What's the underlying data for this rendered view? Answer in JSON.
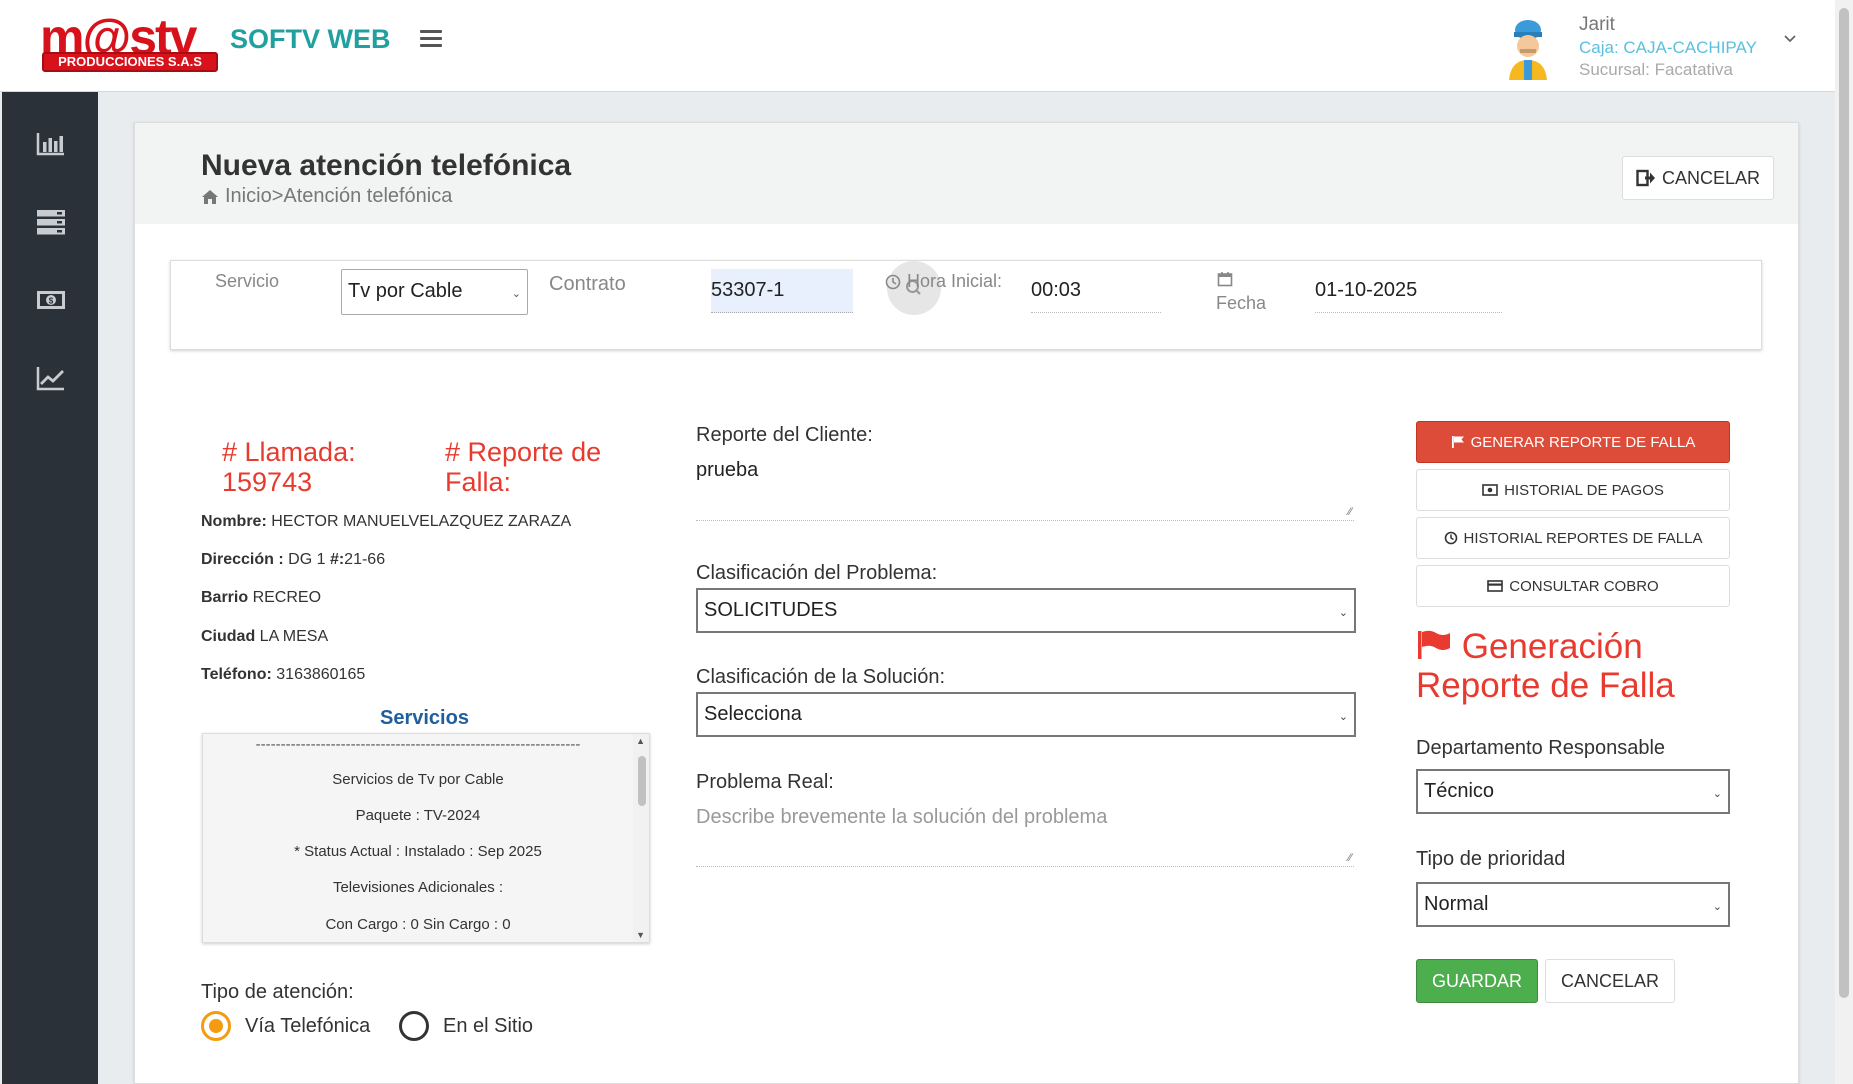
{
  "header": {
    "logo_text_main": "m@stv",
    "logo_text_sub": "PRODUCCIONES S.A.S",
    "app_name": "SOFTV WEB",
    "menu_icon": "hamburger-icon",
    "user": {
      "name": "Jarit",
      "caja": "Caja: CAJA-CACHIPAY",
      "sucursal": "Sucursal: Facatativa",
      "avatar_icon": "user-avatar-icon",
      "dropdown_icon": "chevron-down-icon"
    }
  },
  "sidebar": {
    "items": [
      {
        "icon": "bar-chart-icon"
      },
      {
        "icon": "server-icon"
      },
      {
        "icon": "money-icon"
      },
      {
        "icon": "line-chart-icon"
      }
    ]
  },
  "page": {
    "title": "Nueva atención telefónica",
    "breadcrumb": "Inicio>Atención telefónica",
    "cancel_label": "CANCELAR"
  },
  "filters": {
    "servicio_label": "Servicio",
    "servicio_value": "Tv por Cable",
    "contrato_label": "Contrato",
    "contrato_value": "53307-1",
    "hora_label": "Hora Inicial:",
    "hora_value": "00:03",
    "fecha_label": "Fecha",
    "fecha_value": "01-10-2025"
  },
  "left": {
    "llamada_label": "# Llamada:",
    "llamada_value": "159743",
    "reporte_label": "# Reporte de Falla:",
    "nombre_label": "Nombre:",
    "nombre_value": "HECTOR MANUELVELAZQUEZ ZARAZA",
    "direccion_label": "Dirección :",
    "direccion_value": "DG 1",
    "direccion_num_label": "#:",
    "direccion_num_value": "21-66",
    "barrio_label": "Barrio",
    "barrio_value": "RECREO",
    "ciudad_label": "Ciudad",
    "ciudad_value": "LA MESA",
    "telefono_label": "Teléfono:",
    "telefono_value": "3163860165",
    "servicios_title": "Servicios",
    "servicios_lines": [
      "-----------------------------------------------------------------",
      "Servicios de Tv por Cable",
      "Paquete : TV-2024",
      "* Status Actual : Instalado : Sep 2025",
      "Televisiones Adicionales :",
      "Con Cargo : 0 Sin Cargo : 0"
    ],
    "tipo_label": "Tipo de atención:",
    "tipo_options": [
      "Vía Telefónica",
      "En el Sitio"
    ],
    "tipo_selected": "Vía Telefónica"
  },
  "middle": {
    "reporte_label": "Reporte del Cliente:",
    "reporte_value": "prueba",
    "clasif_problema_label": "Clasificación del Problema:",
    "clasif_problema_value": "SOLICITUDES",
    "clasif_solucion_label": "Clasificación de la Solución:",
    "clasif_solucion_value": "Selecciona",
    "problema_real_label": "Problema Real:",
    "problema_real_placeholder": "Describe brevemente la solución del problema"
  },
  "right": {
    "generar_label": "GENERAR REPORTE DE FALLA",
    "historial_pagos_label": "HISTORIAL DE PAGOS",
    "historial_reportes_label": "HISTORIAL REPORTES DE FALLA",
    "consultar_cobro_label": "CONSULTAR COBRO",
    "gen_title": "Generación Reporte de Falla",
    "departamento_label": "Departamento Responsable",
    "departamento_value": "Técnico",
    "prioridad_label": "Tipo de prioridad",
    "prioridad_value": "Normal",
    "guardar_label": "GUARDAR",
    "cancelar_label": "CANCELAR"
  },
  "colors": {
    "accent_red": "#e83a2e",
    "danger_button": "#dd4b39",
    "success_button": "#4cae4c",
    "sidebar": "#2b3139",
    "app_name": "#21a0a0",
    "radio_selected": "#f39c12"
  }
}
